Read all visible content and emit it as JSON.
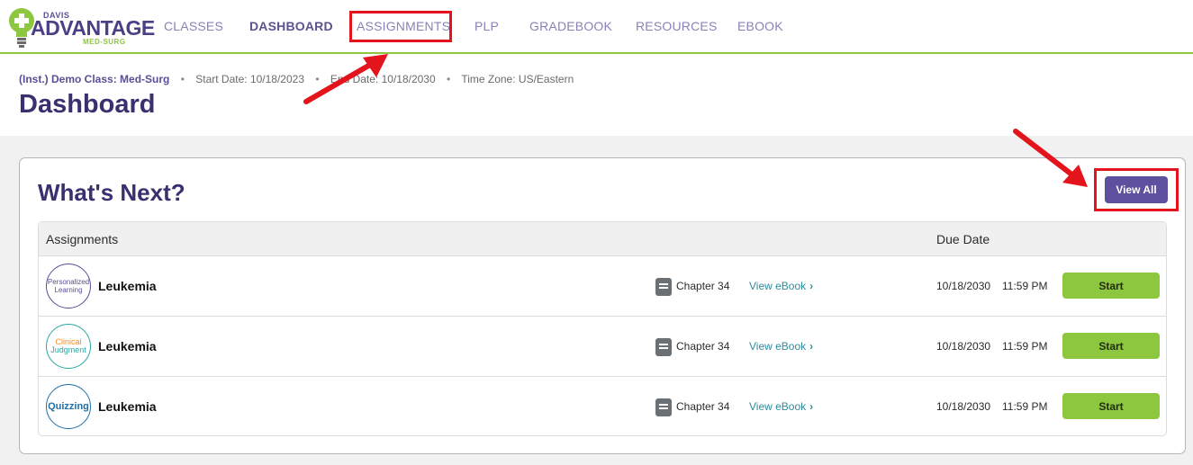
{
  "logo": {
    "top": "DAVIS",
    "main": "ADVANTAGE",
    "sub": "MED-SURG"
  },
  "nav": {
    "items": [
      {
        "label": "CLASSES"
      },
      {
        "label": "DASHBOARD"
      },
      {
        "label": "ASSIGNMENTS"
      },
      {
        "label": "PLP"
      },
      {
        "label": "GRADEBOOK"
      },
      {
        "label": "RESOURCES"
      },
      {
        "label": "EBOOK"
      }
    ],
    "active": "DASHBOARD"
  },
  "class_info": {
    "name": "(Inst.) Demo Class: Med-Surg",
    "separator": "•",
    "start": "Start Date: 10/18/2023",
    "end": "End Date: 10/18/2030",
    "timezone": "Time Zone: US/Eastern"
  },
  "page_title": "Dashboard",
  "card": {
    "title": "What's Next?",
    "view_all_label": "View All",
    "columns": {
      "assignments": "Assignments",
      "due_date": "Due Date"
    },
    "rows": [
      {
        "badge_line1": "Personalized",
        "badge_line2": "Learning",
        "name": "Leukemia",
        "chapter": "Chapter 34",
        "ebook_link": "View eBook",
        "chevron": "›",
        "date": "10/18/2030",
        "time": "11:59 PM",
        "action": "Start"
      },
      {
        "badge_line1": "Clinical",
        "badge_line2": "Judgment",
        "name": "Leukemia",
        "chapter": "Chapter 34",
        "ebook_link": "View eBook",
        "chevron": "›",
        "date": "10/18/2030",
        "time": "11:59 PM",
        "action": "Start"
      },
      {
        "badge_line1": "Quizzing",
        "badge_line2": "",
        "name": "Leukemia",
        "chapter": "Chapter 34",
        "ebook_link": "View eBook",
        "chevron": "›",
        "date": "10/18/2030",
        "time": "11:59 PM",
        "action": "Start"
      }
    ]
  },
  "colors": {
    "brand_purple": "#5e4f9f",
    "accent_green": "#8dc63f",
    "highlight_red": "#e3141b",
    "link_teal": "#2e8b9b"
  },
  "icons": {
    "logo": "lightbulb-logo-icon",
    "book": "book-icon",
    "chevron": "chevron-right-icon",
    "annotation": "red-arrow-icon"
  }
}
